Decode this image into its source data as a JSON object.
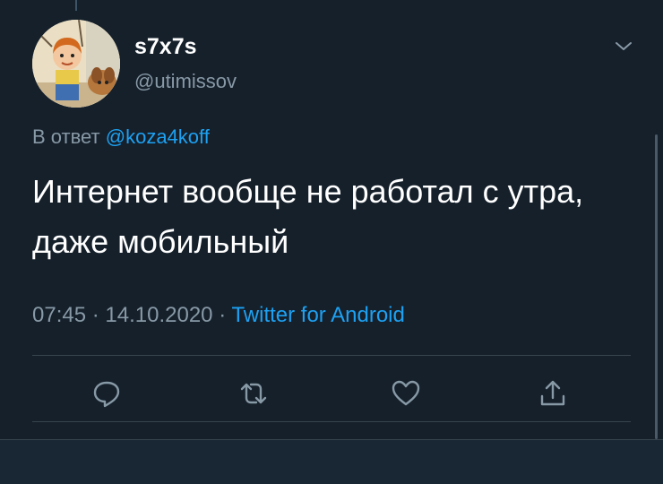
{
  "tweet": {
    "user": {
      "display_name": "s7x7s",
      "handle": "@utimissov",
      "avatar_icon": "avatar-cartoon-boy-with-dog"
    },
    "reply": {
      "prefix": "В ответ",
      "mention": "@koza4koff"
    },
    "text": "Интернет вообще не работал с утра, даже мобильный",
    "time": "07:45",
    "separator": "·",
    "date": "14.10.2020",
    "source": "Twitter for Android",
    "actions": [
      {
        "name": "reply",
        "icon": "comment-icon"
      },
      {
        "name": "retweet",
        "icon": "retweet-icon"
      },
      {
        "name": "like",
        "icon": "heart-icon"
      },
      {
        "name": "share",
        "icon": "share-icon"
      }
    ]
  },
  "colors": {
    "background": "#15202b",
    "secondary_text": "#8899a6",
    "accent": "#1da1f2",
    "divider": "#38444d"
  }
}
